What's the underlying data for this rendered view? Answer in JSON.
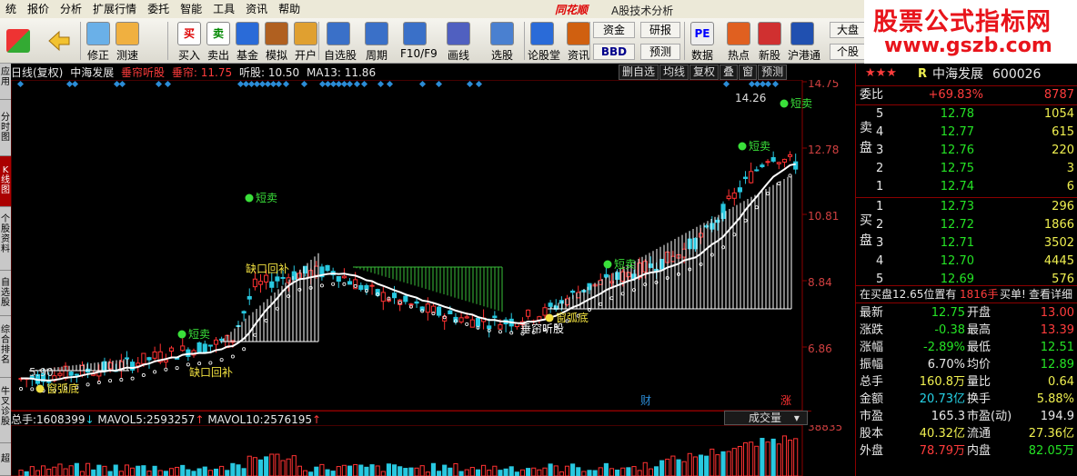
{
  "menu": [
    "统",
    "报价",
    "分析",
    "扩展行情",
    "委托",
    "智能",
    "工具",
    "资讯",
    "帮助"
  ],
  "brand": {
    "logo": "同花顺",
    "subtitle": "A股技术分析"
  },
  "watermark": {
    "title": "股票公式指标网",
    "url": "www.gszb.com"
  },
  "toolbar": {
    "buttons": [
      {
        "label": "修正",
        "icon": "up-down-arrows-icon"
      },
      {
        "label": "测速",
        "icon": "speed-dial-icon"
      },
      {
        "label": "买入",
        "icon": "buy-icon",
        "glyph": "买"
      },
      {
        "label": "卖出",
        "icon": "sell-icon",
        "glyph": "卖"
      },
      {
        "label": "基金",
        "icon": "fund-icon"
      },
      {
        "label": "模拟",
        "icon": "gavel-icon"
      },
      {
        "label": "开户",
        "icon": "lock-icon"
      },
      {
        "label": "自选股",
        "icon": "star-icon"
      },
      {
        "label": "周期",
        "icon": "clock-icon"
      },
      {
        "label": "F10/F9",
        "icon": "f10-icon"
      },
      {
        "label": "画线",
        "icon": "pen-icon"
      },
      {
        "label": "选股",
        "icon": "select-icon"
      },
      {
        "label": "论股堂",
        "icon": "forum-icon"
      },
      {
        "label": "资讯",
        "icon": "news-icon"
      },
      {
        "label": "数据",
        "icon": "pe-icon",
        "glyph": "PE"
      },
      {
        "label": "热点",
        "icon": "hot-icon"
      },
      {
        "label": "新股",
        "icon": "ipo-icon"
      },
      {
        "label": "沪港通",
        "icon": "sse-hkex-icon"
      }
    ],
    "fund_btn": "资金",
    "bbd_btn": "BBD",
    "research_btn": "研报",
    "forecast_btn": "预测",
    "market_btn": "大盘",
    "stock_btn": "个股"
  },
  "left_tabs": [
    "应用",
    "分时图",
    "K线图",
    "个股资料",
    "自选股",
    "综合排名",
    "牛叉诊股",
    "超"
  ],
  "chart_header": {
    "period": "日线(复权)",
    "name": "中海发展",
    "indicator": "垂帘听股",
    "v1_label": "垂帘:",
    "v1": "11.75",
    "v2_label": "听股:",
    "v2": "10.50",
    "v3_label": "MA13:",
    "v3": "11.86"
  },
  "chart_buttons": [
    "删自选",
    "均线",
    "复权",
    "叠",
    "窗",
    "预测"
  ],
  "chart_annotations": {
    "sell": "短卖",
    "gap": "缺口回补",
    "bottom": "窗弧底",
    "indicator_label": "垂帘听股",
    "low_label": "5.90",
    "high_label": "14.26",
    "finance_mark": "财",
    "rise_mark": "涨"
  },
  "price_axis": [
    "14.75",
    "12.78",
    "10.81",
    "8.84",
    "6.86"
  ],
  "vol_header": {
    "total_label": "总手:",
    "total": "1608399",
    "ma5_label": "MAVOL5:",
    "ma5": "2593257",
    "ma10_label": "MAVOL10:",
    "ma10": "2576195"
  },
  "vol_axis": "38835",
  "indicator_select": "成交量",
  "quote": {
    "stars": "★★★",
    "r": "R",
    "name": "中海发展",
    "code": "600026",
    "webi_label": "委比",
    "webi": "+69.83%",
    "webi_diff": "8787",
    "sell_label": "卖盘",
    "buy_label": "买盘",
    "sell": [
      {
        "lvl": "5",
        "price": "12.78",
        "vol": "1054"
      },
      {
        "lvl": "4",
        "price": "12.77",
        "vol": "615"
      },
      {
        "lvl": "3",
        "price": "12.76",
        "vol": "220"
      },
      {
        "lvl": "2",
        "price": "12.75",
        "vol": "3"
      },
      {
        "lvl": "1",
        "price": "12.74",
        "vol": "6"
      }
    ],
    "buy": [
      {
        "lvl": "1",
        "price": "12.73",
        "vol": "296"
      },
      {
        "lvl": "2",
        "price": "12.72",
        "vol": "1866"
      },
      {
        "lvl": "3",
        "price": "12.71",
        "vol": "3502"
      },
      {
        "lvl": "4",
        "price": "12.70",
        "vol": "4445"
      },
      {
        "lvl": "5",
        "price": "12.69",
        "vol": "576"
      }
    ],
    "status_text": "在买盘12.65位置有",
    "status_qty": "1816手",
    "status_action": "买单!",
    "detail_link": "查看详细",
    "stats": [
      {
        "l1": "最新",
        "v1": "12.75",
        "c1": "green",
        "l2": "开盘",
        "v2": "13.00",
        "c2": "red"
      },
      {
        "l1": "涨跌",
        "v1": "-0.38",
        "c1": "green",
        "l2": "最高",
        "v2": "13.39",
        "c2": "red"
      },
      {
        "l1": "涨幅",
        "v1": "-2.89%",
        "c1": "green",
        "l2": "最低",
        "v2": "12.51",
        "c2": "green"
      },
      {
        "l1": "振幅",
        "v1": "6.70%",
        "c1": "white",
        "l2": "均价",
        "v2": "12.89",
        "c2": "green"
      },
      {
        "l1": "总手",
        "v1": "160.8万",
        "c1": "yellow",
        "l2": "量比",
        "v2": "0.64",
        "c2": "yellow"
      },
      {
        "l1": "金额",
        "v1": "20.73亿",
        "c1": "cyan",
        "l2": "换手",
        "v2": "5.88%",
        "c2": "yellow"
      },
      {
        "l1": "市盈",
        "v1": "165.3",
        "c1": "white",
        "l2": "市盈(动)",
        "v2": "194.9",
        "c2": "white"
      },
      {
        "l1": "股本",
        "v1": "40.32亿",
        "c1": "yellow",
        "l2": "流通",
        "v2": "27.36亿",
        "c2": "yellow"
      },
      {
        "l1": "外盘",
        "v1": "78.79万",
        "c1": "red",
        "l2": "内盘",
        "v2": "82.05万",
        "c2": "green"
      }
    ]
  }
}
